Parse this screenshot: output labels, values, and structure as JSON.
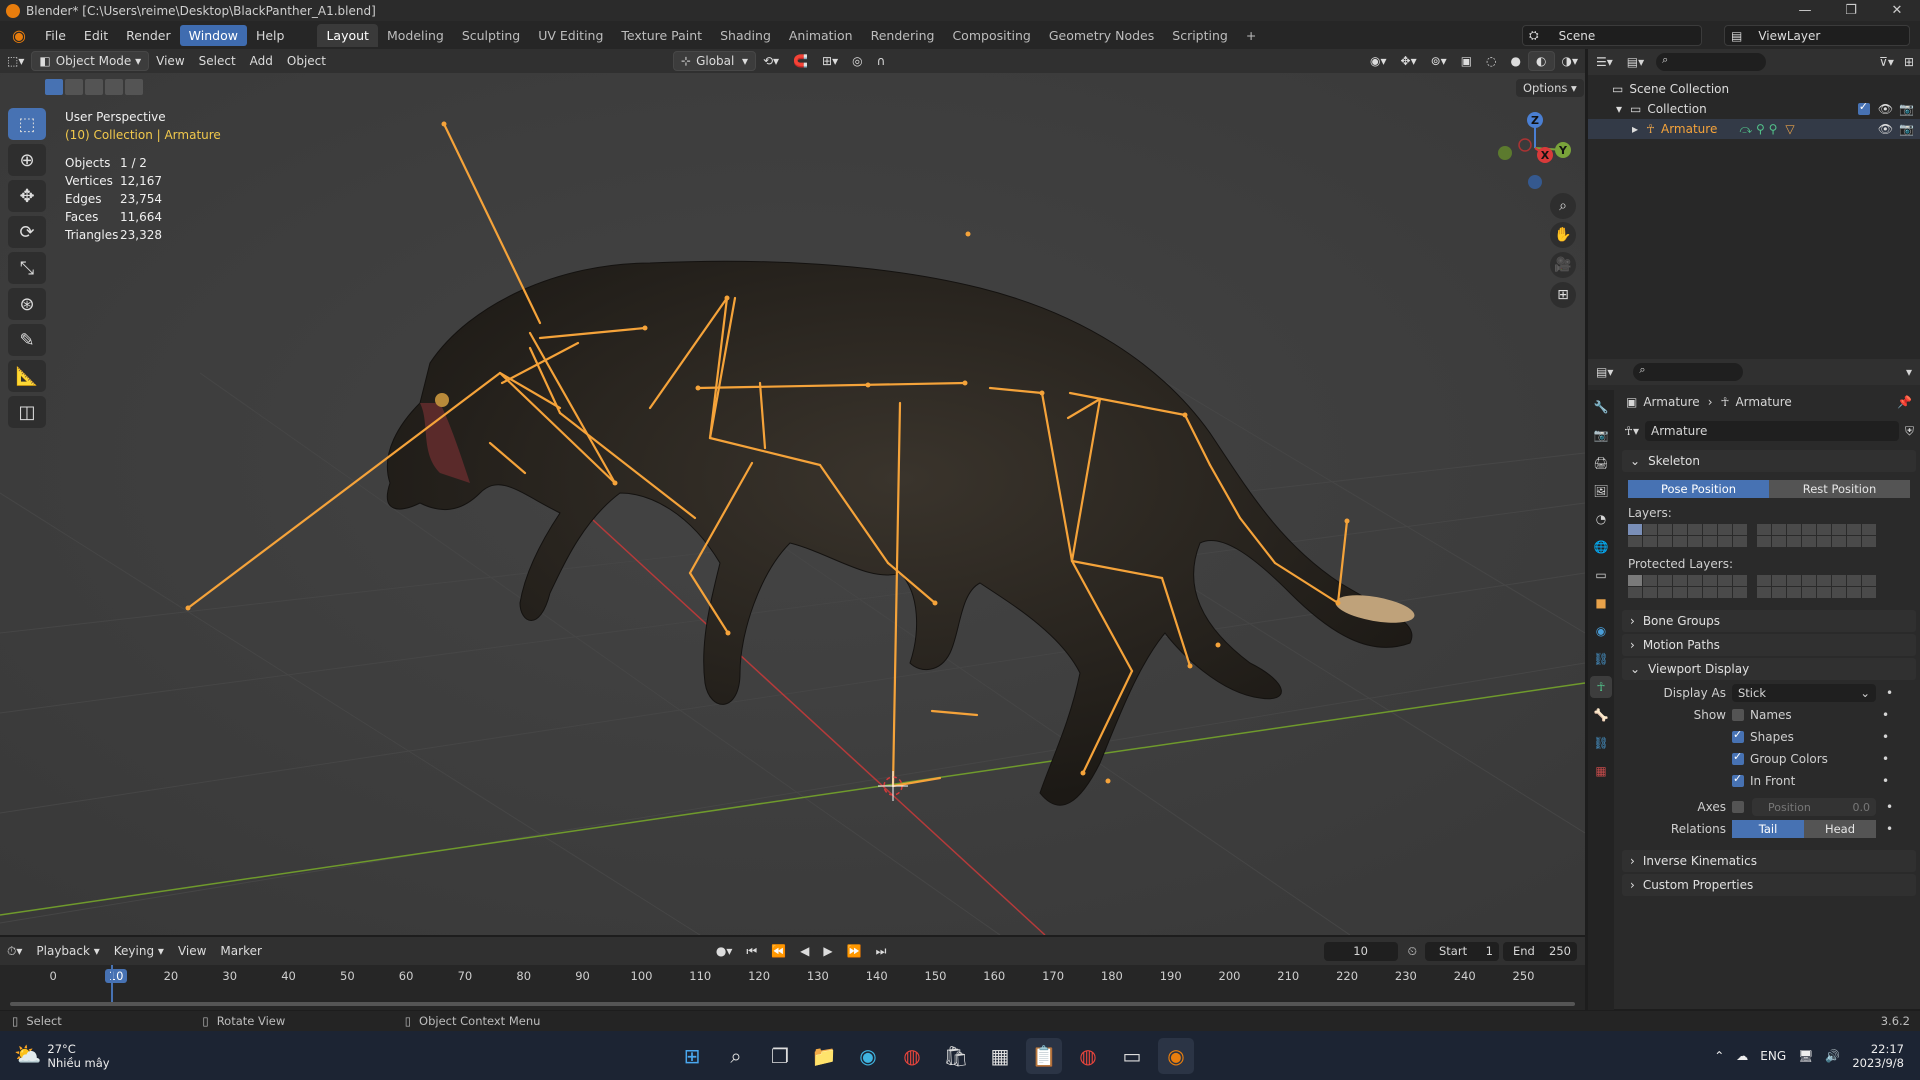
{
  "title_bar": {
    "title": "Blender* [C:\\Users\\reime\\Desktop\\BlackPanther_A1.blend]"
  },
  "menu": [
    "File",
    "Edit",
    "Render",
    "Window",
    "Help"
  ],
  "menu_active": "Window",
  "workspaces": [
    "Layout",
    "Modeling",
    "Sculpting",
    "UV Editing",
    "Texture Paint",
    "Shading",
    "Animation",
    "Rendering",
    "Compositing",
    "Geometry Nodes",
    "Scripting"
  ],
  "workspace_active": "Layout",
  "scene": {
    "name": "Scene",
    "view_layer": "ViewLayer"
  },
  "viewport_header": {
    "mode": "Object Mode",
    "menus": [
      "View",
      "Select",
      "Add",
      "Object"
    ],
    "orientation": "Global",
    "options": "Options"
  },
  "viewport": {
    "perspective": "User Perspective",
    "collection_info": "(10) Collection | Armature",
    "stats": [
      {
        "label": "Objects",
        "value": "1 / 2"
      },
      {
        "label": "Vertices",
        "value": "12,167"
      },
      {
        "label": "Edges",
        "value": "23,754"
      },
      {
        "label": "Faces",
        "value": "11,664"
      },
      {
        "label": "Triangles",
        "value": "23,328"
      }
    ],
    "axes": {
      "x": "X",
      "y": "Y",
      "z": "Z"
    },
    "colors": {
      "bone": "#f5a33a",
      "x_axis": "#b53a3a",
      "y_axis": "#6f9a2c",
      "panther": "#2a2622"
    }
  },
  "outliner": {
    "scene_collection": "Scene Collection",
    "collection": "Collection",
    "armature": "Armature"
  },
  "properties": {
    "breadcrumb": [
      "Armature",
      "Armature"
    ],
    "data_name": "Armature",
    "skeleton": "Skeleton",
    "pose_position": "Pose Position",
    "rest_position": "Rest Position",
    "layers": "Layers:",
    "protected_layers": "Protected Layers:",
    "panels": [
      "Bone Groups",
      "Motion Paths"
    ],
    "viewport_display": "Viewport Display",
    "display_as_label": "Display As",
    "display_as_value": "Stick",
    "show_label": "Show",
    "show_options": [
      {
        "label": "Names",
        "checked": false
      },
      {
        "label": "Shapes",
        "checked": true
      },
      {
        "label": "Group Colors",
        "checked": true
      },
      {
        "label": "In Front",
        "checked": true
      }
    ],
    "axes_label": "Axes",
    "axes_position": "Position",
    "axes_value": "0.0",
    "relations_label": "Relations",
    "relations_tail": "Tail",
    "relations_head": "Head",
    "bottom_panels": [
      "Inverse Kinematics",
      "Custom Properties"
    ]
  },
  "timeline": {
    "menus": [
      "Playback",
      "Keying",
      "View",
      "Marker"
    ],
    "current_frame": "10",
    "start_label": "Start",
    "start": "1",
    "end_label": "End",
    "end": "250",
    "ticks": [
      "0",
      "10",
      "20",
      "30",
      "40",
      "50",
      "60",
      "70",
      "80",
      "90",
      "100",
      "110",
      "120",
      "130",
      "140",
      "150",
      "160",
      "170",
      "180",
      "190",
      "200",
      "210",
      "220",
      "230",
      "240",
      "250"
    ]
  },
  "status_bar": {
    "select": "Select",
    "rotate": "Rotate View",
    "context": "Object Context Menu",
    "version": "3.6.2"
  },
  "taskbar": {
    "temperature": "27°C",
    "weather": "Nhiều mây",
    "lang": "ENG",
    "time": "22:17",
    "date": "2023/9/8"
  }
}
